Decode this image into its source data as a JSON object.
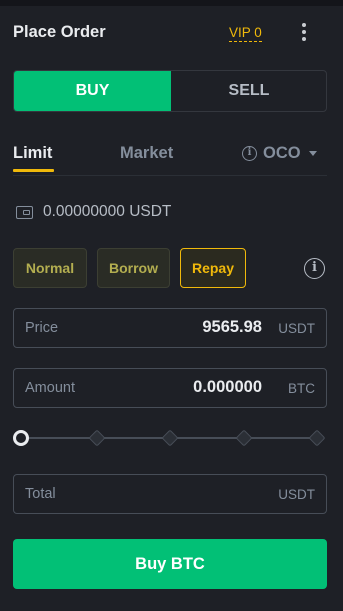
{
  "header": {
    "title": "Place Order",
    "vip_label": "VIP 0"
  },
  "side": {
    "buy_label": "BUY",
    "sell_label": "SELL",
    "selected": "BUY"
  },
  "order_tabs": {
    "limit": "Limit",
    "market": "Market",
    "oco": "OCO",
    "active": "Limit"
  },
  "balance": {
    "text": "0.00000000 USDT"
  },
  "modes": {
    "normal": "Normal",
    "borrow": "Borrow",
    "repay": "Repay",
    "active": "Repay"
  },
  "price": {
    "label": "Price",
    "value": "9565.98",
    "unit": "USDT"
  },
  "amount": {
    "label": "Amount",
    "value": "0.000000",
    "unit": "BTC"
  },
  "slider": {
    "percent": 0,
    "steps": [
      0,
      25,
      50,
      75,
      100
    ]
  },
  "total": {
    "label": "Total",
    "unit": "USDT"
  },
  "cta": {
    "label": "Buy BTC"
  },
  "colors": {
    "buy": "#02C076",
    "accent": "#F0B90B",
    "background": "#1E2026"
  },
  "icons": {
    "more": "kebab-menu-icon",
    "info": "info-icon",
    "wallet": "wallet-icon",
    "dropdown": "chevron-down-icon"
  }
}
